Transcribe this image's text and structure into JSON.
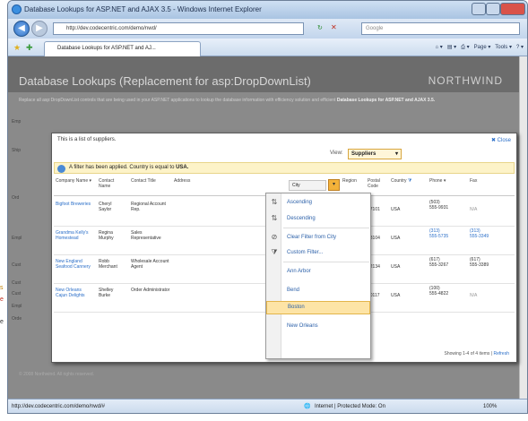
{
  "window": {
    "title": "Database Lookups for ASP.NET and AJAX 3.5 - Windows Internet Explorer"
  },
  "browser": {
    "address": "http://dev.codecentric.com/demo/nwd/",
    "search_placeholder": "Google",
    "tab_label": "Database Lookups for ASP.NET and AJ...",
    "toolbar": {
      "page": "Page",
      "tools": "Tools"
    },
    "status_url": "http://dev.codecentric.com/demo/nwd/#",
    "status_zone": "Internet | Protected Mode: On",
    "zoom": "100%"
  },
  "page": {
    "heading": "Database Lookups (Replacement for asp:DropDownList)",
    "brand": "NORTHWIND",
    "intro": "Replace all asp:DropDownList controls that are being used in your ASP.NET applications to lookup the database information with",
    "intro_bold": "Database Lookups for ASP.NET and AJAX 3.5.",
    "intro_pre": "efficiency solution and efficient",
    "copyright": "© 2008 Northwind. All rights reserved."
  },
  "sidebar_labels": [
    "Emp",
    "Ship",
    "Ord",
    "Empl",
    "Cust",
    "Cust",
    "Cust",
    "Empl",
    "Orde"
  ],
  "panel": {
    "title": "This is a list of suppliers.",
    "close": "Close",
    "view_label": "View:",
    "view_value": "Suppliers",
    "filter_text": "A filter has been applied. Country is equal to",
    "filter_value": "USA.",
    "columns": [
      "Company Name",
      "Contact Name",
      "Contact Title",
      "Address",
      "City",
      "Region",
      "Postal Code",
      "Country",
      "Phone",
      "Fax"
    ],
    "rows": [
      {
        "company": "Bigfoot Breweries",
        "contact": "Cheryl Saylor",
        "title": "Regional Account Rep.",
        "region": "OR",
        "postal": "97101",
        "country": "USA",
        "phone": "(503) 555-9931",
        "fax": "N/A"
      },
      {
        "company": "Grandma Kelly's Homestead",
        "contact": "Regina Murphy",
        "title": "Sales Representative",
        "region": "MI",
        "postal": "48104",
        "country": "USA",
        "phone": "(313) 555-5735",
        "fax": "(313) 555-3349"
      },
      {
        "company": "New England Seafood Cannery",
        "contact": "Robb Merchant",
        "title": "Wholesale Account Agent",
        "region": "MA",
        "postal": "02134",
        "country": "USA",
        "phone": "(617) 555-3267",
        "fax": "(617) 555-3389"
      },
      {
        "company": "New Orleans Cajun Delights",
        "contact": "Shelley Burke",
        "title": "Order Administrator",
        "region": "LA",
        "postal": "70117",
        "country": "USA",
        "phone": "(100) 555-4822",
        "fax": "N/A"
      }
    ],
    "pager": "Showing 1-4 of 4 items |",
    "refresh": "Refresh"
  },
  "menu": {
    "items": [
      "Ascending",
      "Descending",
      "Clear Filter from City",
      "Custom Filter...",
      "Ann Arbor",
      "Bend",
      "Boston",
      "New Orleans"
    ]
  },
  "colors": {
    "accent": "#2a6ec8",
    "highlight": "#fde4a6",
    "page_bg": "#8a8a8a"
  }
}
